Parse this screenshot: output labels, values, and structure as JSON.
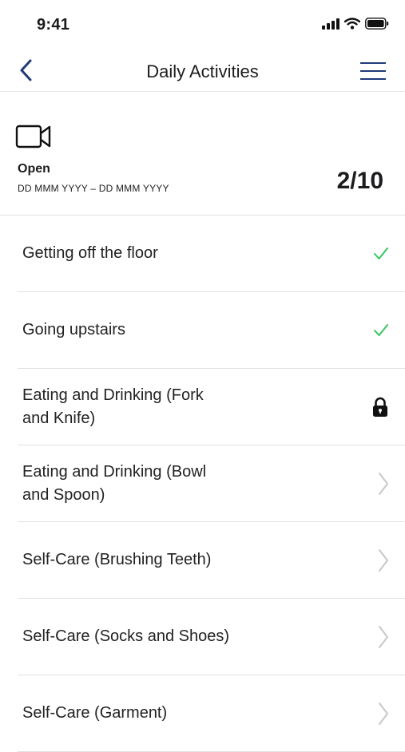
{
  "status_bar": {
    "time": "9:41"
  },
  "nav": {
    "title": "Daily Activities"
  },
  "summary": {
    "status": "Open",
    "dates": "DD MMM YYYY  –  DD MMM YYYY",
    "count": "2/10"
  },
  "items": [
    {
      "label": "Getting off the floor",
      "state": "done"
    },
    {
      "label": "Going upstairs",
      "state": "done"
    },
    {
      "label": "Eating and Drinking (Fork and Knife)",
      "state": "locked"
    },
    {
      "label": "Eating and Drinking (Bowl and Spoon)",
      "state": "available"
    },
    {
      "label": "Self-Care (Brushing Teeth)",
      "state": "available"
    },
    {
      "label": "Self-Care (Socks and Shoes)",
      "state": "available"
    },
    {
      "label": "Self-Care (Garment)",
      "state": "available"
    }
  ],
  "colors": {
    "accent": "#1e3a78",
    "check": "#34c759",
    "chevron": "#c7c7cc"
  }
}
